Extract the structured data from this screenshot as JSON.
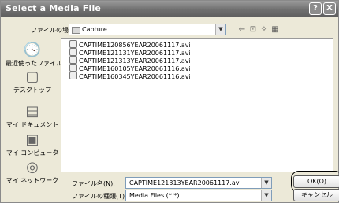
{
  "window": {
    "title": "Select a Media File",
    "help_label": "?",
    "close_label": "X"
  },
  "location": {
    "label": "ファイルの場所(I):",
    "folder": "Capture",
    "toolbar": {
      "back": "←",
      "up": "⊡",
      "new_folder": "✧",
      "view": "▦"
    }
  },
  "places": [
    {
      "label": "最近使ったファイル",
      "icon": "recent-documents-icon"
    },
    {
      "label": "デスクトップ",
      "icon": "desktop-icon"
    },
    {
      "label": "マイ ドキュメント",
      "icon": "my-documents-icon"
    },
    {
      "label": "マイ コンピュータ",
      "icon": "my-computer-icon"
    },
    {
      "label": "マイ ネットワーク",
      "icon": "my-network-icon"
    }
  ],
  "files": [
    "CAPTIME120856YEAR20061117.avi",
    "CAPTIME121131YEAR20061117.avi",
    "CAPTIME121313YEAR20061117.avi",
    "CAPTIME160105YEAR20061116.avi",
    "CAPTIME160345YEAR20061116.avi"
  ],
  "filename": {
    "label": "ファイル名(N):",
    "value": "CAPTIME121313YEAR20061117.avi"
  },
  "filetype": {
    "label": "ファイルの種類(T):",
    "value": "Media Files (*.*)"
  },
  "buttons": {
    "ok": "OK(O)",
    "cancel": "キャンセル"
  }
}
